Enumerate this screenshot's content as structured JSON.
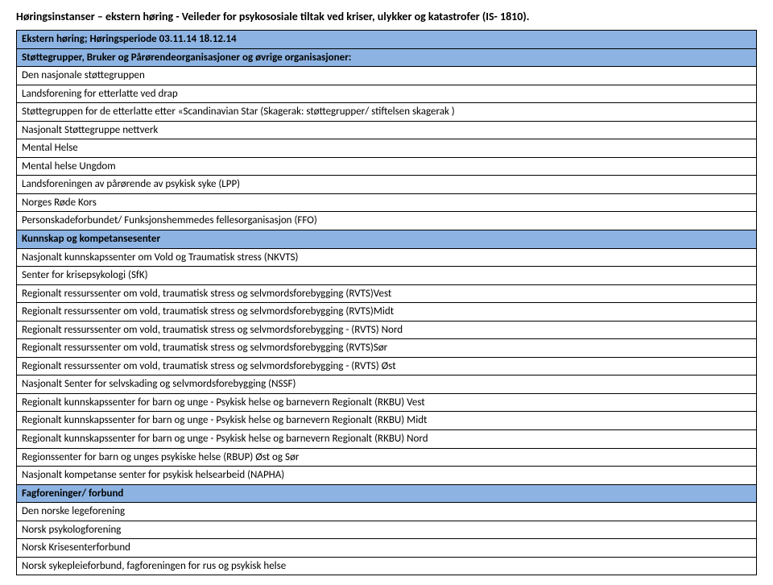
{
  "title": "Høringsinstanser – ekstern høring - Veileder for psykososiale tiltak ved kriser, ulykker og katastrofer (IS- 1810).",
  "periodHeader": "Ekstern høring; Høringsperiode 03.11.14  18.12.14",
  "section1": {
    "header": "Støttegrupper, Bruker og Pårørendeorganisasjoner og øvrige organisasjoner:",
    "rows": [
      "Den nasjonale støttegruppen",
      "Landsforening for etterlatte ved drap",
      "Støttegruppen for de etterlatte etter «Scandinavian Star (Skagerak: støttegrupper/ stiftelsen skagerak )",
      "Nasjonalt Støttegruppe nettverk",
      "Mental Helse",
      "Mental helse Ungdom",
      "Landsforeningen av pårørende av psykisk syke (LPP)",
      "Norges Røde Kors",
      "Personskadeforbundet/ Funksjonshemmedes fellesorganisasjon (FFO)"
    ]
  },
  "section2": {
    "header": "Kunnskap og kompetansesenter",
    "rows": [
      "Nasjonalt kunnskapssenter om Vold og Traumatisk stress (NKVTS)",
      "Senter for krisepsykologi (SfK)",
      "Regionalt ressurssenter om vold, traumatisk stress og selvmordsforebygging (RVTS)Vest",
      "Regionalt ressurssenter om vold, traumatisk stress og selvmordsforebygging (RVTS)Midt",
      "Regionalt ressurssenter om vold, traumatisk stress og selvmordsforebygging -  (RVTS) Nord",
      "Regionalt ressurssenter om vold, traumatisk stress og selvmordsforebygging (RVTS)Sør",
      "Regionalt ressurssenter om vold, traumatisk stress og selvmordsforebygging -  (RVTS) Øst",
      "Nasjonalt Senter for selvskading og selvmordsforebygging (NSSF)",
      "Regionalt kunnskapssenter for barn og unge - Psykisk helse og barnevern Regionalt (RKBU) Vest",
      "Regionalt kunnskapssenter for barn og unge - Psykisk helse og barnevern Regionalt (RKBU) Midt",
      "Regionalt kunnskapssenter for barn og unge - Psykisk helse og barnevern Regionalt (RKBU) Nord",
      "Regionssenter for barn og unges psykiske helse (RBUP) Øst og Sør",
      "Nasjonalt kompetanse senter for psykisk helsearbeid (NAPHA)"
    ]
  },
  "section3": {
    "header": "Fagforeninger/ forbund",
    "rows": [
      "Den norske legeforening",
      "Norsk psykologforening",
      "Norsk Krisesenterforbund",
      "Norsk sykepleieforbund, fagforeningen for rus og psykisk helse"
    ]
  }
}
